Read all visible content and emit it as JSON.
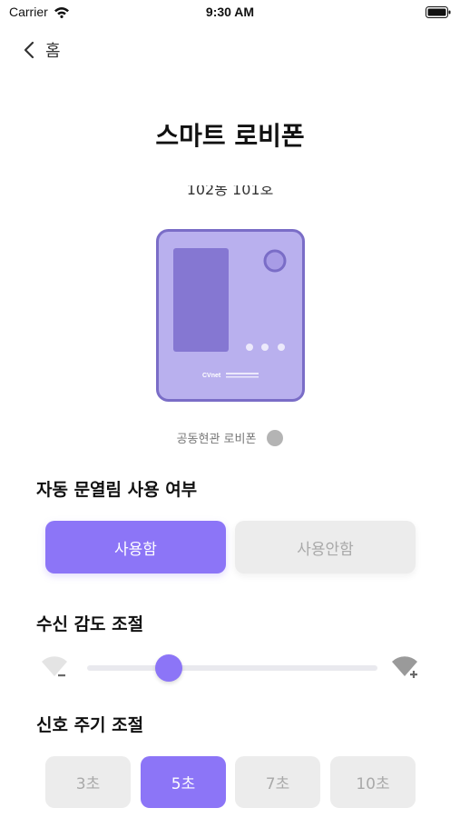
{
  "status_bar": {
    "carrier": "Carrier",
    "time": "9:30 AM"
  },
  "nav": {
    "back_label": "홈"
  },
  "title": "스마트 로비폰",
  "unit": "102동 101호",
  "device": {
    "caption": "공동현관 로비폰",
    "brand": "CVnet",
    "accent_color": "#b9b0ee",
    "status_color": "#b4b4b4"
  },
  "auto_open": {
    "label": "자동 문열림 사용 여부",
    "options": [
      "사용함",
      "사용안함"
    ],
    "selected": "사용함"
  },
  "sensitivity": {
    "label": "수신 감도 조절",
    "value": 0.28
  },
  "period": {
    "label": "신호 주기 조절",
    "options": [
      "3초",
      "5초",
      "7초",
      "10초"
    ],
    "selected": "5초"
  },
  "colors": {
    "accent": "#8c75f7",
    "inactive_bg": "#ececec",
    "inactive_text": "#a9a9a9"
  }
}
